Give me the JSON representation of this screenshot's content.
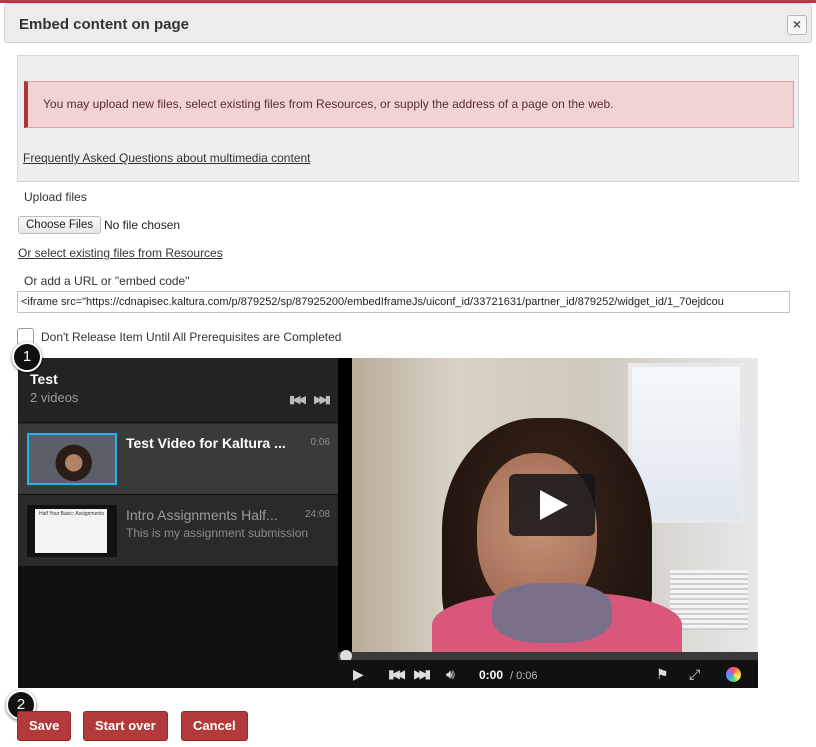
{
  "dialog": {
    "title": "Embed content on page",
    "close_label": "×"
  },
  "info": {
    "alert_text": "You may upload new files, select existing files from Resources, or supply the address of a page on the web.",
    "faq_link": "Frequently Asked Questions about multimedia content"
  },
  "upload": {
    "label": "Upload files",
    "choose_button": "Choose Files",
    "no_file_text": "No file chosen",
    "resources_link": "Or select existing files from Resources"
  },
  "url": {
    "label": "Or add a URL or \"embed code\"",
    "value": "<iframe src=\"https://cdnapisec.kaltura.com/p/879252/sp/87925200/embedIframeJs/uiconf_id/33721631/partner_id/879252/widget_id/1_70ejdcou"
  },
  "prereq": {
    "label": "Don't Release Item Until All Prerequisites are Completed",
    "checked": false
  },
  "playlist": {
    "title": "Test",
    "count": "2 videos",
    "items": [
      {
        "title": "Test Video for Kaltura ...",
        "duration": "0:06",
        "description": "",
        "active": true
      },
      {
        "title": "Intro Assignments Half...",
        "duration": "24:08",
        "description": "This is my assignment submission",
        "active": false
      }
    ],
    "slide_thumb_text": "Half Your Basic: Assignments"
  },
  "player": {
    "current_time": "0:00",
    "duration": "/ 0:06",
    "icons": [
      "play-icon",
      "previous-icon",
      "next-icon",
      "volume-icon",
      "flag-icon",
      "fullscreen-icon",
      "kaltura-logo-icon"
    ]
  },
  "steps": [
    "1",
    "2"
  ],
  "buttons": {
    "save": "Save",
    "start_over": "Start over",
    "cancel": "Cancel"
  },
  "colors": {
    "button_bg": "#b33a3a",
    "alert_bg": "#f2d3d3",
    "active_thumb_border": "#1fb6e8"
  }
}
